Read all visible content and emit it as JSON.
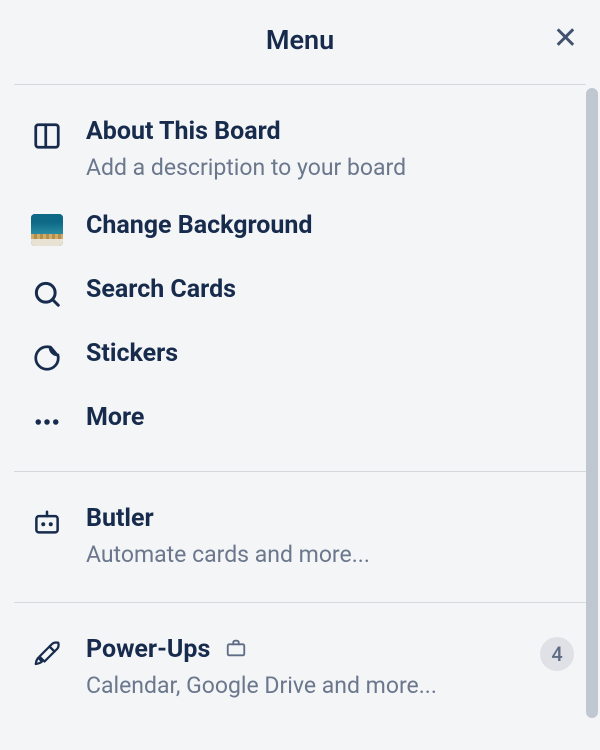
{
  "header": {
    "title": "Menu"
  },
  "sections": {
    "first": {
      "about": {
        "title": "About This Board",
        "sub": "Add a description to your board"
      },
      "changeBg": {
        "title": "Change Background"
      },
      "search": {
        "title": "Search Cards"
      },
      "stickers": {
        "title": "Stickers"
      },
      "more": {
        "title": "More"
      }
    },
    "butler": {
      "title": "Butler",
      "sub": "Automate cards and more..."
    },
    "powerups": {
      "title": "Power-Ups",
      "sub": "Calendar, Google Drive and more...",
      "badge": "4"
    }
  }
}
